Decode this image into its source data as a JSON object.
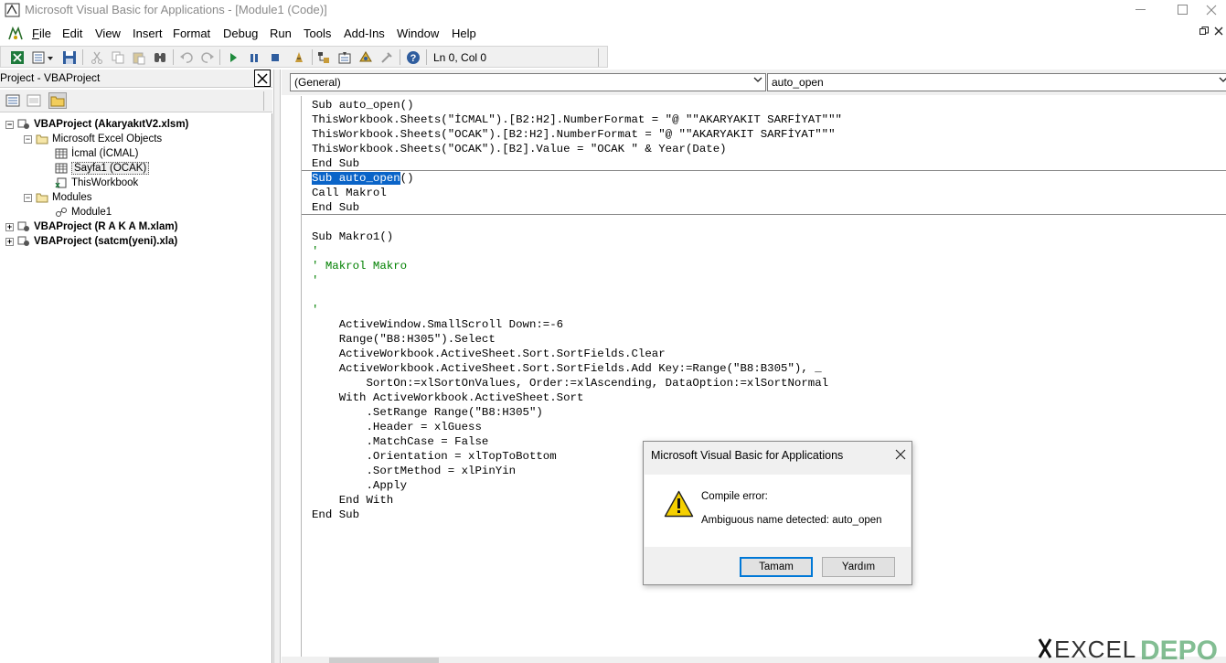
{
  "window": {
    "title": "Microsoft Visual Basic for Applications - [Module1 (Code)]",
    "controls": [
      "minimize",
      "maximize",
      "close"
    ]
  },
  "menu": {
    "items": [
      {
        "label": "File",
        "access": "F"
      },
      {
        "label": "Edit",
        "access": "E"
      },
      {
        "label": "View",
        "access": "V"
      },
      {
        "label": "Insert",
        "access": "I"
      },
      {
        "label": "Format",
        "access": "o"
      },
      {
        "label": "Debug",
        "access": "D"
      },
      {
        "label": "Run",
        "access": "R"
      },
      {
        "label": "Tools",
        "access": "T"
      },
      {
        "label": "Add-Ins",
        "access": "A"
      },
      {
        "label": "Window",
        "access": "W"
      },
      {
        "label": "Help",
        "access": "H"
      }
    ],
    "mdi_restore": "⬚",
    "mdi_close": "✕"
  },
  "toolbar": {
    "position_text": "Ln 0, Col 0"
  },
  "project": {
    "title": "Project - VBAProject",
    "close": "✕",
    "tree": {
      "p1": "VBAProject (AkaryakıtV2.xlsm)",
      "objects_folder": "Microsoft Excel Objects",
      "sheet1": "İcmal (İCMAL)",
      "sheet2": "Sayfa1 (OCAK)",
      "workbook": "ThisWorkbook",
      "modules_folder": "Modules",
      "module1": "Module1",
      "p2": "VBAProject (R A K A M.xlam)",
      "p3": "VBAProject (satcm(yeni).xla)"
    }
  },
  "code": {
    "object_combo": "(General)",
    "procedure_combo": "auto_open",
    "lines": [
      {
        "text": "Sub auto_open()",
        "kind": "code"
      },
      {
        "text": "ThisWorkbook.Sheets(\"İCMAL\").[B2:H2].NumberFormat = \"@ \"\"AKARYAKIT SARFİYAT\"\"\"",
        "kind": "code"
      },
      {
        "text": "ThisWorkbook.Sheets(\"OCAK\").[B2:H2].NumberFormat = \"@ \"\"AKARYAKIT SARFİYAT\"\"\"",
        "kind": "code"
      },
      {
        "text": "ThisWorkbook.Sheets(\"OCAK\").[B2].Value = \"OCAK \" & Year(Date)",
        "kind": "code"
      },
      {
        "text": "End Sub",
        "kind": "code"
      },
      {
        "text": "()",
        "kind": "selected",
        "selected": "Sub auto_open"
      },
      {
        "text": "Call Makrol",
        "kind": "code"
      },
      {
        "text": "End Sub",
        "kind": "code"
      },
      {
        "text": "",
        "kind": "code"
      },
      {
        "text": "Sub Makro1()",
        "kind": "code"
      },
      {
        "text": "'",
        "kind": "comment"
      },
      {
        "text": "' Makrol Makro",
        "kind": "comment"
      },
      {
        "text": "'",
        "kind": "comment"
      },
      {
        "text": "",
        "kind": "code"
      },
      {
        "text": "'",
        "kind": "comment"
      },
      {
        "text": "    ActiveWindow.SmallScroll Down:=-6",
        "kind": "code"
      },
      {
        "text": "    Range(\"B8:H305\").Select",
        "kind": "code"
      },
      {
        "text": "    ActiveWorkbook.ActiveSheet.Sort.SortFields.Clear",
        "kind": "code"
      },
      {
        "text": "    ActiveWorkbook.ActiveSheet.Sort.SortFields.Add Key:=Range(\"B8:B305\"), _",
        "kind": "code"
      },
      {
        "text": "        SortOn:=xlSortOnValues, Order:=xlAscending, DataOption:=xlSortNormal",
        "kind": "code"
      },
      {
        "text": "    With ActiveWorkbook.ActiveSheet.Sort",
        "kind": "code"
      },
      {
        "text": "        .SetRange Range(\"B8:H305\")",
        "kind": "code"
      },
      {
        "text": "        .Header = xlGuess",
        "kind": "code"
      },
      {
        "text": "        .MatchCase = False",
        "kind": "code"
      },
      {
        "text": "        .Orientation = xlTopToBottom",
        "kind": "code"
      },
      {
        "text": "        .SortMethod = xlPinYin",
        "kind": "code"
      },
      {
        "text": "        .Apply",
        "kind": "code"
      },
      {
        "text": "    End With",
        "kind": "code"
      },
      {
        "text": "End Sub",
        "kind": "code"
      }
    ]
  },
  "dialog": {
    "title": "Microsoft Visual Basic for Applications",
    "heading": "Compile error:",
    "message": "Ambiguous name detected: auto_open",
    "ok_label": "Tamam",
    "help_label": "Yardım",
    "close": "✕"
  },
  "watermark": {
    "text": "EXCEL DEPO"
  },
  "colors": {
    "selection": "#0a64c8",
    "comment": "#008000",
    "dialog_primary_border": "#0078d7",
    "warning_yellow": "#f5d000"
  }
}
